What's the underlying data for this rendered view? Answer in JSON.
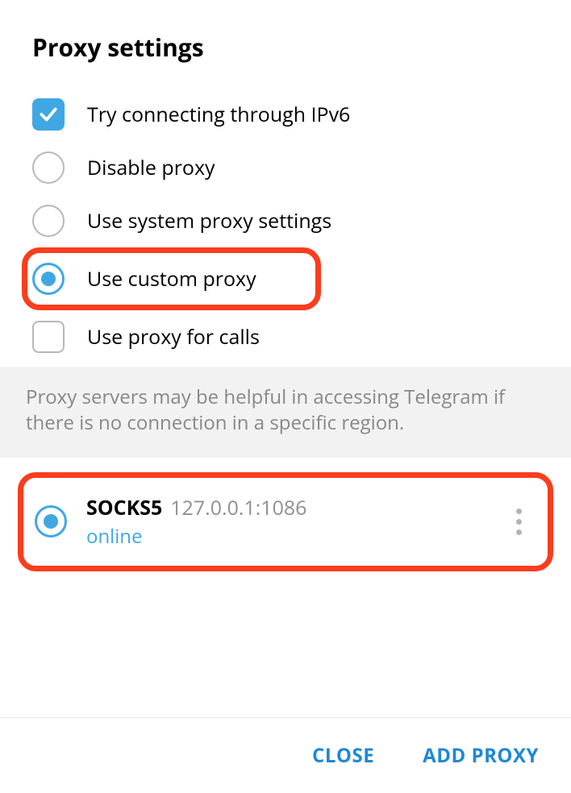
{
  "title": "Proxy settings",
  "options": {
    "ipv6": {
      "label": "Try connecting through IPv6",
      "checked": true
    },
    "disable": {
      "label": "Disable proxy",
      "selected": false
    },
    "system": {
      "label": "Use system proxy settings",
      "selected": false
    },
    "custom": {
      "label": "Use custom proxy",
      "selected": true
    },
    "calls": {
      "label": "Use proxy for calls",
      "checked": false
    }
  },
  "info_text": "Proxy servers may be helpful in accessing Telegram if there is no connection in a specific region.",
  "proxy_entry": {
    "protocol": "SOCKS5",
    "address": "127.0.0.1:1086",
    "status": "online",
    "selected": true
  },
  "footer": {
    "close": "CLOSE",
    "add": "ADD PROXY"
  }
}
